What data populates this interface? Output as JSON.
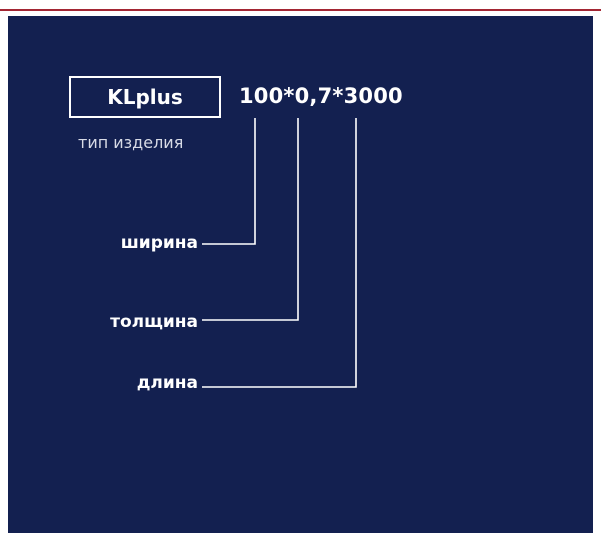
{
  "diagram": {
    "product": {
      "name": "KLplus",
      "caption": "тип изделия"
    },
    "spec": "100*0,7*3000",
    "labels": {
      "width": "ширина",
      "thickness": "толщина",
      "length": "длина"
    }
  },
  "colors": {
    "background": "#132050",
    "accent_rule": "#a32633",
    "text": "#ffffff"
  }
}
